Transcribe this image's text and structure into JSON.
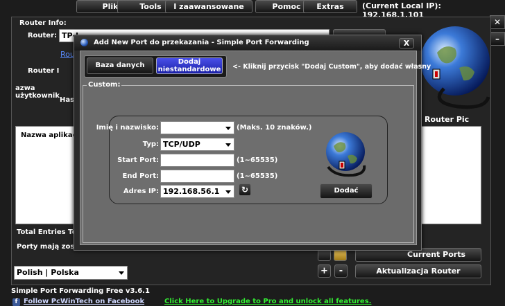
{
  "menu": {
    "plik": "Plik",
    "tools": "Tools",
    "advanced": "I zaawansowane",
    "help": "Pomoc",
    "extras": "Extras",
    "local_ip": "(Current Local IP): 192.168.1.101"
  },
  "main": {
    "router_info_legend": "Router Info:",
    "router_label": "Router:",
    "router_value": "TP-L",
    "router_link": "Rou",
    "router_i_label": "Router I",
    "username_label": "azwa użytkownik",
    "password_label": "Has",
    "router_pic_label": "Router Pic",
    "app_name_header": "Nazwa aplikacj",
    "total_entries": "Total Entries To",
    "ports_text": "Porty mają zosta",
    "language": "Polish | Polska",
    "btn_plus": "+",
    "btn_minus": "-",
    "btn_current_ports": "Current Ports",
    "btn_update_router": "Aktualizacja Router",
    "version": "Simple Port Forwarding Free v3.6.1",
    "facebook": "Follow PcWinTech on Facebook",
    "upgrade": "Click Here to Upgrade to Pro and unlock all features."
  },
  "dialog": {
    "title": "Add New Port do przekazania - Simple Port Forwarding",
    "close": "X",
    "tab_database": "Baza danych",
    "tab_custom": "Dodaj niestandardowe",
    "hint": "<- Kliknij przycisk \"Dodaj Custom\", aby dodać własny",
    "custom_legend": "Custom:",
    "name_label": "Imię i nazwisko:",
    "name_value": "",
    "name_hint": "(Maks. 10 znaków.)",
    "type_label": "Typ:",
    "type_value": "TCP/UDP",
    "start_label": "Start Port:",
    "start_value": "",
    "start_hint": "(1~65535)",
    "end_label": "End Port:",
    "end_value": "",
    "end_hint": "(1~65535)",
    "ip_label": "Adres IP:",
    "ip_value": "192.168.56.1",
    "add_button": "Dodać"
  },
  "colors": {
    "upgrade_link": "#33ee33",
    "tab_active": "#2a30c8",
    "dialog_bg": "#6b6b6b"
  }
}
